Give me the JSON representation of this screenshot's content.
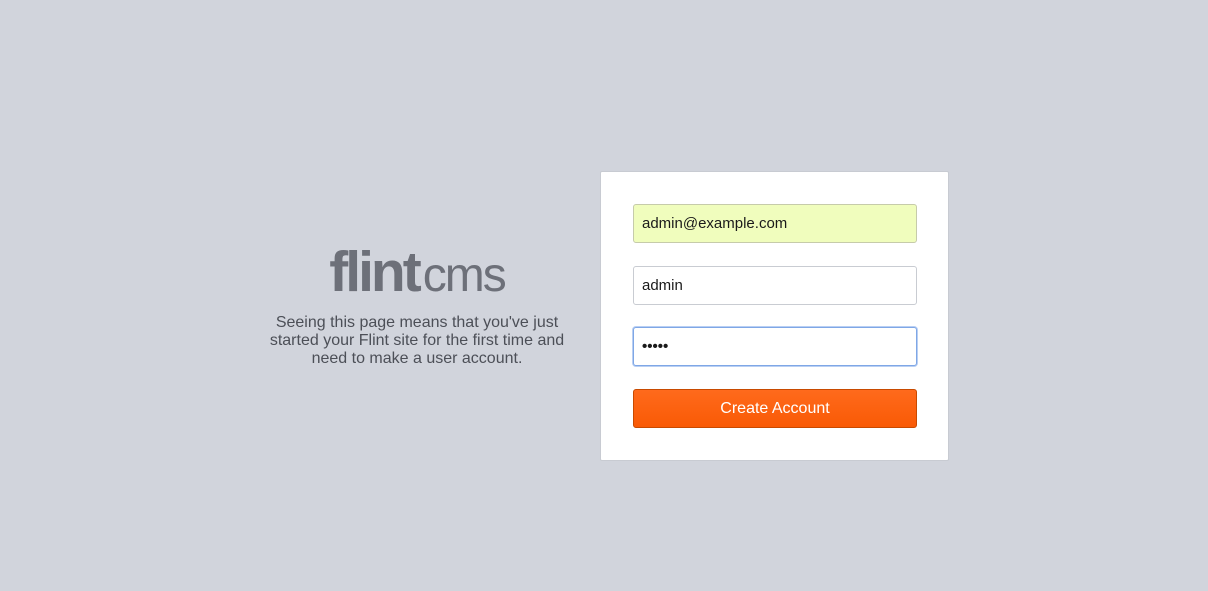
{
  "logo": {
    "bold": "flint",
    "light": "cms"
  },
  "intro": {
    "text": "Seeing this page means that you've just started your Flint site for the first time and need to make a user account."
  },
  "form": {
    "email_value": "admin@example.com",
    "username_value": "admin",
    "password_value": "•••••",
    "submit_label": "Create Account"
  },
  "colors": {
    "background": "#d1d4dc",
    "accent": "#ff6210",
    "autofill": "#f0fdbd"
  }
}
